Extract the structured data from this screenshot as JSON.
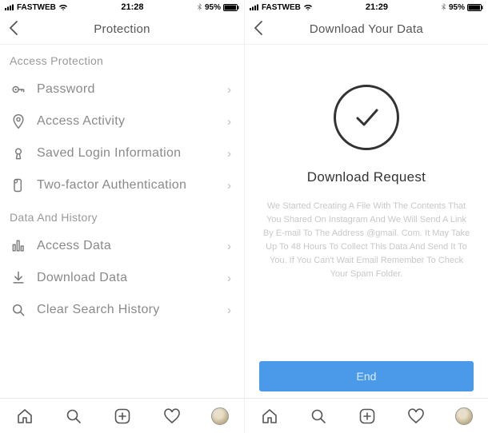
{
  "left": {
    "status": {
      "carrier": "FASTWEB",
      "time": "21:28",
      "battery": "95%"
    },
    "header": {
      "title": "Protection"
    },
    "section1": {
      "title": "Access Protection"
    },
    "items1": {
      "password": "Password",
      "activity": "Access Activity",
      "savedLogin": "Saved Login Information",
      "twoFactor": "Two-factor Authentication"
    },
    "section2": {
      "title": "Data And History"
    },
    "items2": {
      "accessData": "Access Data",
      "downloadData": "Download Data",
      "clearHistory": "Clear Search History"
    }
  },
  "right": {
    "status": {
      "carrier": "FASTWEB",
      "time": "21:29",
      "battery": "95%"
    },
    "header": {
      "title": "Download Your Data"
    },
    "content": {
      "title": "Download Request",
      "body": "We Started Creating A File With The Contents That You Shared On Instagram And We Will Send A Link By E-mail To The Address @gmail. Com. It May Take Up To 48 Hours To Collect This Data And Send It To You. If You Can't Wait Email Remember To Check Your Spam Folder."
    },
    "button": {
      "label": "End"
    }
  }
}
